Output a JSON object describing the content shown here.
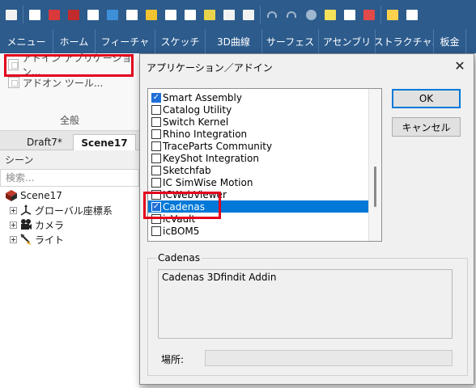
{
  "quick_access_icons": [
    "app-logo-icon",
    "new-icon",
    "open-red-icon",
    "drawing-icon",
    "template-icon",
    "open-file-icon",
    "options-icon",
    "folder-icon",
    "save-icon",
    "save-as-icon",
    "wand-icon",
    "transfer-icon",
    "import-icon",
    "undo-icon",
    "redo-icon",
    "render-icon",
    "sparkle-icon",
    "properties-icon",
    "send-icon",
    "copy-icon",
    "view-menu-icon"
  ],
  "ribbon_tabs": [
    "メニュー",
    "ホーム",
    "フィーチャ",
    "スケッチ",
    "3D曲線",
    "サーフェス",
    "アセンブリ",
    "ストラクチャ.",
    "板金"
  ],
  "ribbon_panel": {
    "items": [
      {
        "label": "アドイン アプリケーション..."
      },
      {
        "label": "アドオン ツール..."
      }
    ],
    "group_label": "全般"
  },
  "doc_tabs": [
    {
      "label": "Draft7*"
    },
    {
      "label": "Scene17"
    }
  ],
  "scene_panel": {
    "title": "シーン",
    "search_placeholder": "検索..."
  },
  "tree": {
    "root": "Scene17",
    "children": [
      "グローバル座標系",
      "カメラ",
      "ライト"
    ]
  },
  "dialog": {
    "title": "アプリケーション／アドイン",
    "close_glyph": "✕",
    "ok_label": "OK",
    "cancel_label": "キャンセル",
    "addins": [
      {
        "name": "Smart Assembly",
        "checked": true
      },
      {
        "name": "Catalog Utility",
        "checked": false
      },
      {
        "name": "Switch Kernel",
        "checked": false
      },
      {
        "name": "Rhino Integration",
        "checked": false
      },
      {
        "name": "TraceParts Community",
        "checked": false
      },
      {
        "name": "KeyShot Integration",
        "checked": false
      },
      {
        "name": "Sketchfab",
        "checked": false
      },
      {
        "name": "IC SimWise Motion",
        "checked": false
      },
      {
        "name": "ICWebViewer",
        "checked": false
      },
      {
        "name": "Cadenas",
        "checked": true,
        "selected": true
      },
      {
        "name": "icVault",
        "checked": false
      },
      {
        "name": "icBOM5",
        "checked": false
      }
    ],
    "group_title": "Cadenas",
    "description": "Cadenas 3Dfindit Addin",
    "location_label": "場所:",
    "location_value": ""
  },
  "colors": {
    "toolbar_bg": "#2c5b8c",
    "highlight_red": "#e3001b",
    "selection_blue": "#0078d7"
  }
}
